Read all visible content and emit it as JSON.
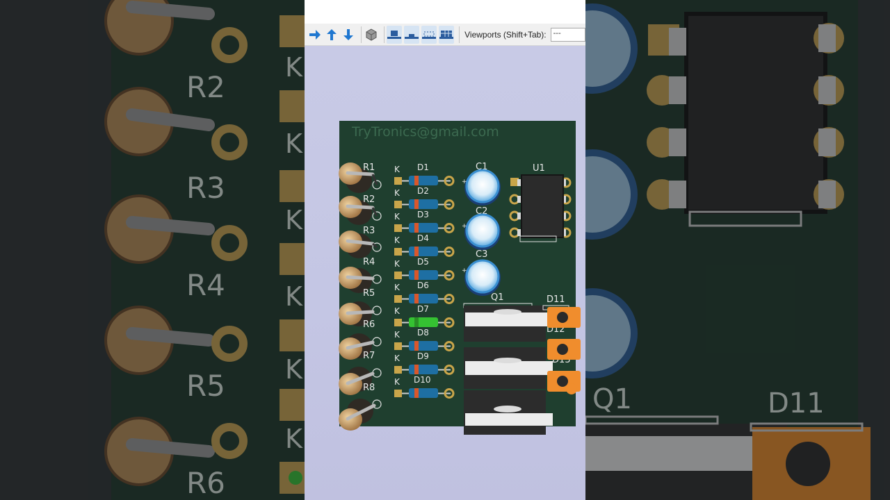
{
  "toolbar": {
    "viewports_label": "Viewports (Shift+Tab):",
    "viewports_value": "---",
    "buttons": [
      "arrow-right-icon",
      "arrow-up-icon",
      "arrow-down-icon",
      "cube-icon",
      "view-top-icon",
      "view-side-icon",
      "view-dashed-icon",
      "view-grid-icon"
    ]
  },
  "board": {
    "silkscreen_email": "TryTronics@gmail.com",
    "resistors": [
      "R1",
      "R2",
      "R3",
      "R4",
      "R5",
      "R6",
      "R7",
      "R8"
    ],
    "diodes": [
      "D1",
      "D2",
      "D3",
      "D4",
      "D5",
      "D6",
      "D7",
      "D8",
      "D9",
      "D10"
    ],
    "cathode_mark": "K",
    "capacitors": [
      "C1",
      "C2",
      "C3"
    ],
    "ic": "U1",
    "transistor": "Q1",
    "right_diodes": [
      "D11",
      "D12",
      "D13"
    ],
    "colors": {
      "board": "#1f3f2f",
      "silk": "#e8e8e8",
      "pad": "#c9a54a",
      "diode_body": "#1e6fa3",
      "diode_band": "#d9572b",
      "led_green": "#35c232",
      "orange_pad": "#f08d2d"
    }
  },
  "zoom_left": {
    "labels": [
      "R2",
      "R3",
      "R4",
      "R5",
      "R6"
    ],
    "k_mark": "K"
  },
  "zoom_right": {
    "labels": [
      "Q1",
      "D11"
    ]
  }
}
